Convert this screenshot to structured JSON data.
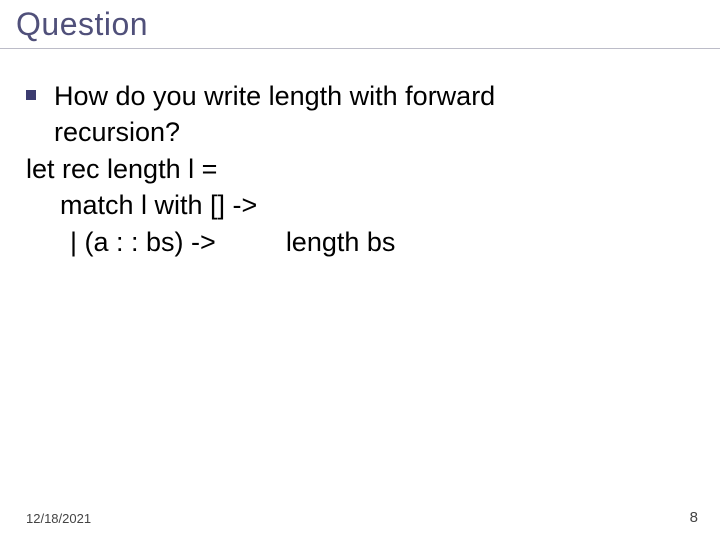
{
  "title": "Question",
  "bullet": {
    "line1": "How do you write length with forward",
    "line2": "recursion?"
  },
  "code": {
    "l1": "let rec length l =",
    "l2": "match l with [] ->",
    "l3a": "| (a : : bs) ->",
    "l3b": "length bs"
  },
  "footer": {
    "date": "12/18/2021",
    "page": "8"
  }
}
